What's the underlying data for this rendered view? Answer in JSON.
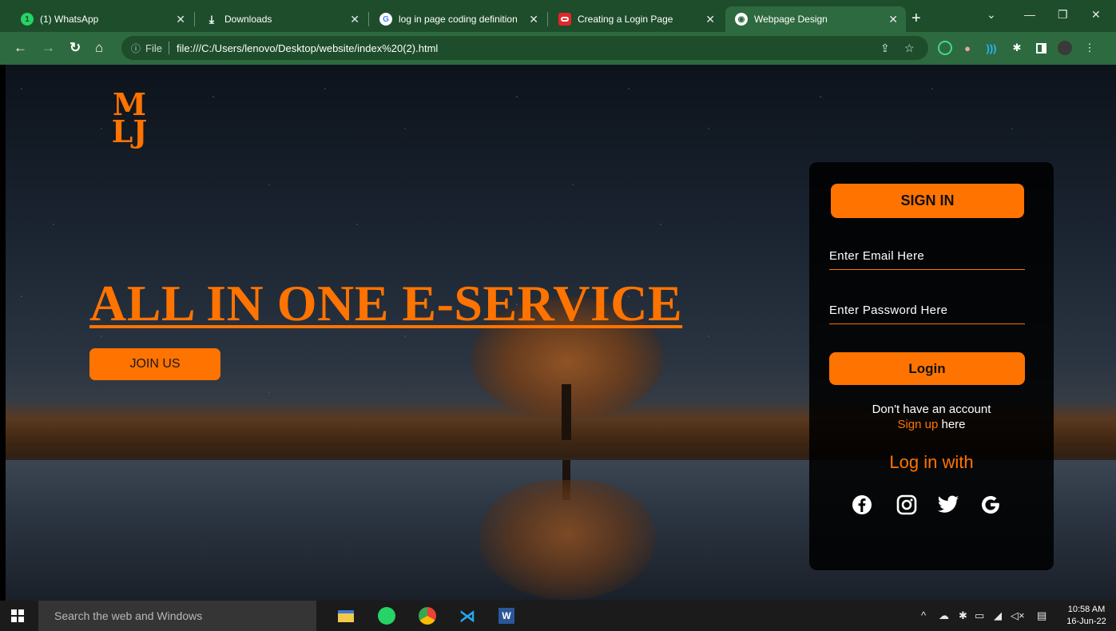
{
  "browser": {
    "tabs": [
      {
        "title": "(1) WhatsApp",
        "icon": "whatsapp-icon",
        "badge": "1",
        "active": false
      },
      {
        "title": "Downloads",
        "icon": "download-icon",
        "active": false
      },
      {
        "title": "log in page coding definition",
        "icon": "google-icon",
        "active": false
      },
      {
        "title": "Creating a Login Page",
        "icon": "oracle-icon",
        "active": false
      },
      {
        "title": "Webpage Design",
        "icon": "globe-icon",
        "active": true
      }
    ],
    "address": {
      "scheme_label": "File",
      "url": "file:///C:/Users/lenovo/Desktop/website/index%20(2).html"
    }
  },
  "page": {
    "logo": {
      "line1": "M",
      "line2": "LJ"
    },
    "hero_title": "ALL IN ONE E-SERVICE",
    "join_button": "JOIN US",
    "login_panel": {
      "signin_tab": "SIGN IN",
      "email_placeholder": "Enter Email Here",
      "password_placeholder": "Enter Password Here",
      "login_button": "Login",
      "no_account_text": "Don't have an account",
      "signup_link": "Sign up",
      "signup_suffix": " here",
      "login_with": "Log in with",
      "social": [
        "facebook-icon",
        "instagram-icon",
        "twitter-icon",
        "google-icon"
      ]
    }
  },
  "taskbar": {
    "search_placeholder": "Search the web and Windows",
    "apps": [
      "file-explorer-icon",
      "whatsapp-icon",
      "chrome-icon",
      "vscode-icon",
      "word-icon"
    ],
    "time": "10:58 AM",
    "date": "16-Jun-22"
  },
  "colors": {
    "accent": "#ff7300",
    "browser_frame": "#1e4d2b",
    "browser_toolbar": "#2e6a3f",
    "panel_bg": "#000000"
  }
}
